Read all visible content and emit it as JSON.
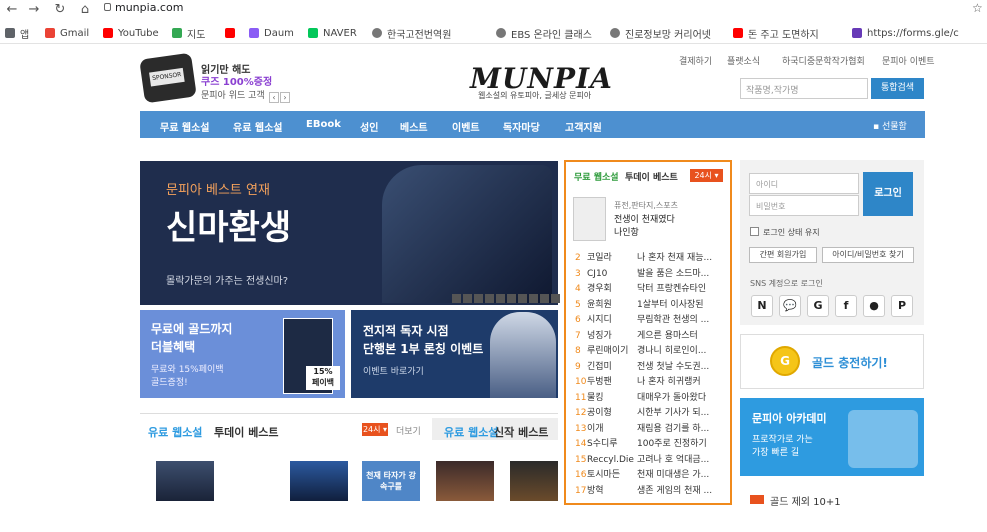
{
  "browser": {
    "url": "munpia.com",
    "bookmarks": [
      {
        "label": "앱",
        "color": "#4285f4"
      },
      {
        "label": "Gmail",
        "color": "#ea4335"
      },
      {
        "label": "YouTube",
        "color": "#ff0000"
      },
      {
        "label": "지도",
        "color": "#34a853"
      },
      {
        "label": "",
        "color": "#ff0000"
      },
      {
        "label": "Daum",
        "color": "#8a5cf5"
      },
      {
        "label": "NAVER",
        "color": "#03c75a"
      },
      {
        "label": "한국고전번역원",
        "color": "#555555"
      },
      {
        "label": "EBS 온라인 클래스",
        "color": "#555555"
      },
      {
        "label": "진로정보망 커리어넷",
        "color": "#555555"
      },
      {
        "label": "돈 주고 도면하지",
        "color": "#ff0000"
      },
      {
        "label": "https://forms.gle/c",
        "color": "#673ab7"
      }
    ]
  },
  "ad": {
    "line1": "읽기만 해도",
    "line2": "쿠즈 100%증정",
    "line3": "문피아 위드 고객"
  },
  "top_links": [
    "결제하기",
    "플랫소식",
    "하국디중문학작가협회",
    "문피아 이벤트"
  ],
  "logo": {
    "text": "MUNPIA",
    "sub": "웹소설의 유토피아, 글세상 문피아"
  },
  "search": {
    "placeholder": "작품명,작가명",
    "button": "통합검색"
  },
  "gnb": {
    "items": [
      "무료 웹소설",
      "유료 웹소설",
      "EBook",
      "성인",
      "베스트",
      "이벤트",
      "독자마당",
      "고객지원"
    ],
    "gift": "선물함"
  },
  "main_banner": {
    "kicker": "문피아 베스트 연재",
    "title": "신마환생",
    "sub": "몰락가문의 가주는 전생신마?"
  },
  "banner_left": {
    "title1": "무료에 골드까지",
    "title2": "더블혜택",
    "sub1": "무료와 15%페이백",
    "sub2": "골드증정!",
    "book_tag": "15%\n페이백"
  },
  "banner_right": {
    "title1": "전지적 독자 시점",
    "title2": "단행본 1부 론칭 이벤트",
    "sub": "이벤트 바로가기"
  },
  "today_best": {
    "title_prefix": "무료 웹소설",
    "title": "투데이 베스트",
    "badge": "24시 ▾",
    "top": {
      "category": "퓨전,판타지,스포츠",
      "title": "전생이 천재였다",
      "author": "나인항"
    },
    "rows": [
      {
        "rank": "2",
        "author": "코일라",
        "title": "나 혼자 천재 재능..."
      },
      {
        "rank": "3",
        "author": "CJ10",
        "title": "발을 품은 소드마..."
      },
      {
        "rank": "4",
        "author": "경우회",
        "title": "닥터 프랑켄슈타인"
      },
      {
        "rank": "5",
        "author": "윤희원",
        "title": "1살부터 이사장된"
      },
      {
        "rank": "6",
        "author": "시지디",
        "title": "무림학관 천생의 ..."
      },
      {
        "rank": "7",
        "author": "넝징가",
        "title": "게으른 용마스터"
      },
      {
        "rank": "8",
        "author": "루린매이기",
        "title": "경나니 히로인이..."
      },
      {
        "rank": "9",
        "author": "긴접미",
        "title": "전생 첫날 수도권..."
      },
      {
        "rank": "10",
        "author": "두벙팬",
        "title": "나 혼자 히귀랭커"
      },
      {
        "rank": "11",
        "author": "물킹",
        "title": "대매우가 돌아왔다"
      },
      {
        "rank": "12",
        "author": "공이형",
        "title": "시한부 기사가 되..."
      },
      {
        "rank": "13",
        "author": "이개",
        "title": "재림용 검기를 하..."
      },
      {
        "rank": "14",
        "author": "S수디루",
        "title": "100주로 진정하기"
      },
      {
        "rank": "15",
        "author": "Reccyl.Die",
        "title": "고려나 호 억대금..."
      },
      {
        "rank": "16",
        "author": "토시마든",
        "title": "천재 미대생은 가..."
      },
      {
        "rank": "17",
        "author": "방혁",
        "title": "생존 게임의 천재 ..."
      }
    ]
  },
  "login": {
    "id_placeholder": "아이디",
    "pw_placeholder": "비밀번호",
    "button": "로그인",
    "keep": "로그인 상태 유지",
    "join": "간편 회원가입",
    "find": "아이디/비밀번호 찾기",
    "sns_label": "SNS 계정으로 로그인",
    "sns": [
      "N",
      "💬",
      "G",
      "f",
      "",
      "P"
    ]
  },
  "gold_charge": {
    "coin": "G",
    "label": "골드 충전하기!"
  },
  "academy": {
    "title": "문피아 아카데미",
    "sub1": "프로작가로 가는",
    "sub2": "가장 빠른 길"
  },
  "gold_event": {
    "label": "골드 제외 10+1"
  },
  "sections": {
    "paid_prefix": "유료 웹소설",
    "paid_title": "투데이 베스트",
    "paid_badge": "24시 ▾",
    "paid_more": "더보기",
    "new_prefix": "유료 웹소설",
    "new_title": "신작 베스트",
    "book_caption": "천재 타자가 강속구를"
  },
  "colors": {
    "accent": "#4d90d0",
    "orange": "#f08a1c",
    "blue_btn": "#2e86c8"
  }
}
